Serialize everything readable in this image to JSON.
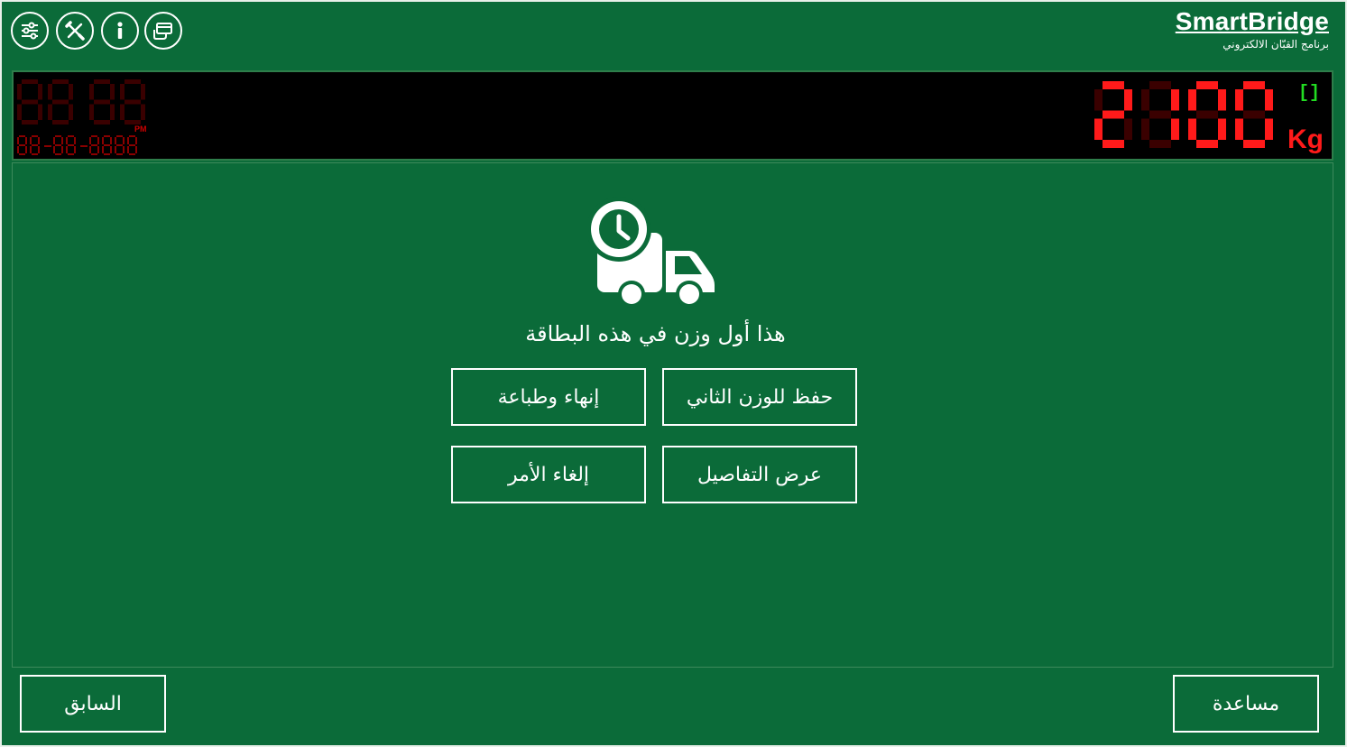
{
  "topbar": {
    "icons": [
      {
        "name": "settings-sliders-icon"
      },
      {
        "name": "tools-icon"
      },
      {
        "name": "info-icon"
      },
      {
        "name": "card-payment-icon"
      }
    ],
    "brand": {
      "title": "SmartBridge",
      "subtitle": "برنامج القبّان الالكتروني"
    }
  },
  "display": {
    "clock_time": "88 88",
    "clock_ampm": "PM",
    "clock_date": "88-88-8888",
    "weight_value": "2100",
    "weight_unit": "Kg",
    "status_indicator": "[]",
    "colors": {
      "digit_on": "#ff1a1a",
      "digit_off": "#3a0000",
      "indicator": "#22dd22"
    }
  },
  "main": {
    "truck_icon": "truck-clock-icon",
    "message": "هذا أول وزن في هذه البطاقة",
    "buttons": {
      "save_second_weight": "حفظ للوزن الثاني",
      "finish_print": "إنهاء وطباعة",
      "show_details": "عرض التفاصيل",
      "cancel": "إلغاء الأمر"
    }
  },
  "footer": {
    "help": "مساعدة",
    "previous": "السابق"
  },
  "colors": {
    "background": "#0b6b39",
    "border": "#ffffff"
  }
}
